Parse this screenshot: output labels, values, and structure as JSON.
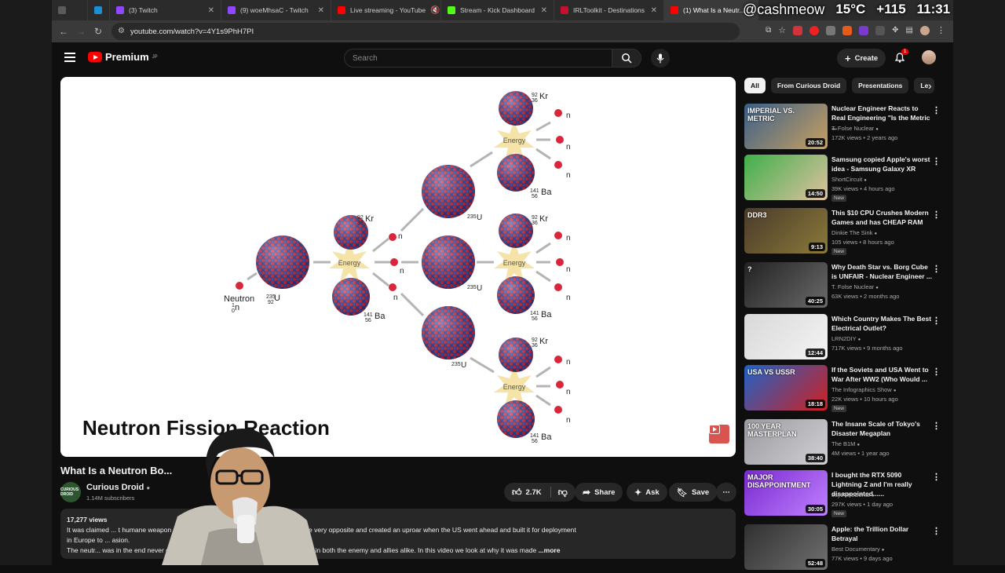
{
  "tabs": [
    {
      "label": "",
      "color": "#5b5b5b"
    },
    {
      "label": "",
      "color": "#1a8fd6"
    },
    {
      "label": "(3) Twitch",
      "color": "#9146ff"
    },
    {
      "label": "(9) woeMhsaC - Twitch",
      "color": "#9146ff"
    },
    {
      "label": "Live streaming - YouTube",
      "color": "#ff0000"
    },
    {
      "label": "Stream - Kick Dashboard",
      "color": "#53fc18"
    },
    {
      "label": "IRLToolkit - Destinations",
      "color": "#c8102e"
    },
    {
      "label": "(1) What Is a Neutr...",
      "color": "#ff0000"
    }
  ],
  "overlay": {
    "handle": "@cashmeow",
    "temp": "15°C",
    "count": "+115",
    "time": "11:31"
  },
  "address": {
    "url": "youtube.com/watch?v=4Y1s9PhH7PI"
  },
  "header": {
    "brand": "Premium",
    "brand_sup": "JP",
    "search_placeholder": "Search",
    "create_label": "Create",
    "notif_count": "1"
  },
  "slide": {
    "title": "Neutron Fission Reaction",
    "neutron_label": "Neutron",
    "energy_label": "Energy",
    "u_mass": "235",
    "u_z": "92",
    "u_sym": "U",
    "kr_mass": "92",
    "kr_z": "36",
    "kr_sym": "Kr",
    "ba_mass": "141",
    "ba_z": "56",
    "ba_sym": "Ba",
    "n_mass": "1",
    "n_z": "0",
    "n_sym": "n"
  },
  "video": {
    "title": "What Is a Neutron Bo...",
    "channel": "Curious Droid",
    "subs": "1.14M subscribers",
    "likes": "2.7K",
    "share": "Share",
    "ask": "Ask",
    "save": "Save",
    "views": "17,277 views",
    "desc_line1": "It was claimed ... t humane weapon ever built  but it has gone down in history as the very opposite and created an uproar when the US  went ahead and built it for deployment",
    "desc_line2": "in Europe to ... asion.",
    "desc_line3": "The neutr... was in the end never deployed but it created a tremendous amount fear in both the enemy and allies alike. In this video we look at why it was made",
    "more": "...more"
  },
  "chips": [
    "All",
    "From Curious Droid",
    "Presentations",
    "Le"
  ],
  "recs": [
    {
      "title": "Nuclear Engineer Reacts to Real Engineering \"Is the Metric ...",
      "channel": "T. Folse Nuclear",
      "meta": "172K views • 2 years ago",
      "duration": "20:52",
      "new": "",
      "thumb_a": "#3a5f8a",
      "thumb_b": "#c8a060",
      "thumb_text": "IMPERIAL VS. METRIC"
    },
    {
      "title": "Samsung copied Apple's worst idea - Samsung Galaxy XR",
      "channel": "ShortCircuit",
      "meta": "39K views • 4 hours ago",
      "duration": "14:50",
      "new": "New",
      "thumb_a": "#3fb04a",
      "thumb_b": "#e0c0a0",
      "thumb_text": ""
    },
    {
      "title": "This $10 CPU Crushes Modern Games and has CHEAP RAM",
      "channel": "Dinkie The Sink",
      "meta": "105 views • 8 hours ago",
      "duration": "9:13",
      "new": "New",
      "thumb_a": "#4a3a2a",
      "thumb_b": "#8a7a3a",
      "thumb_text": "DDR3"
    },
    {
      "title": "Why Death Star vs. Borg Cube is UNFAIR - Nuclear Engineer ...",
      "channel": "T. Folse Nuclear",
      "meta": "63K views • 2 months ago",
      "duration": "40:25",
      "new": "",
      "thumb_a": "#222222",
      "thumb_b": "#6a6a6a",
      "thumb_text": "?"
    },
    {
      "title": "Which Country Makes The Best Electrical Outlet?",
      "channel": "LRN2DIY",
      "meta": "717K views • 9 months ago",
      "duration": "12:44",
      "new": "",
      "thumb_a": "#d8d8d8",
      "thumb_b": "#f4f4f4",
      "thumb_text": ""
    },
    {
      "title": "If the Soviets and USA Went to War After WW2 (Who Would ...",
      "channel": "The Infographics Show",
      "meta": "22K views • 10 hours ago",
      "duration": "18:18",
      "new": "New",
      "thumb_a": "#1e63c8",
      "thumb_b": "#d02020",
      "thumb_text": "USA VS USSR"
    },
    {
      "title": "The Insane Scale of Tokyo's Disaster Megaplan",
      "channel": "The B1M",
      "meta": "4M views • 1 year ago",
      "duration": "38:40",
      "new": "",
      "thumb_a": "#9a9aa0",
      "thumb_b": "#d0d0d4",
      "thumb_text": "100 YEAR MASTERPLAN"
    },
    {
      "title": "I bought the RTX 5090 Lightning Z and I'm really disappointed......",
      "channel": "JayzTwoCents",
      "meta": "297K views • 1 day ago",
      "duration": "30:05",
      "new": "New",
      "thumb_a": "#7a2ad0",
      "thumb_b": "#c080ff",
      "thumb_text": "MAJOR DISAPPOINTMENT"
    },
    {
      "title": "Apple: the Trillion Dollar Betrayal",
      "channel": "Best Documentary",
      "meta": "77K views • 9 days ago",
      "duration": "52:48",
      "new": "",
      "thumb_a": "#303030",
      "thumb_b": "#707070",
      "thumb_text": ""
    }
  ]
}
